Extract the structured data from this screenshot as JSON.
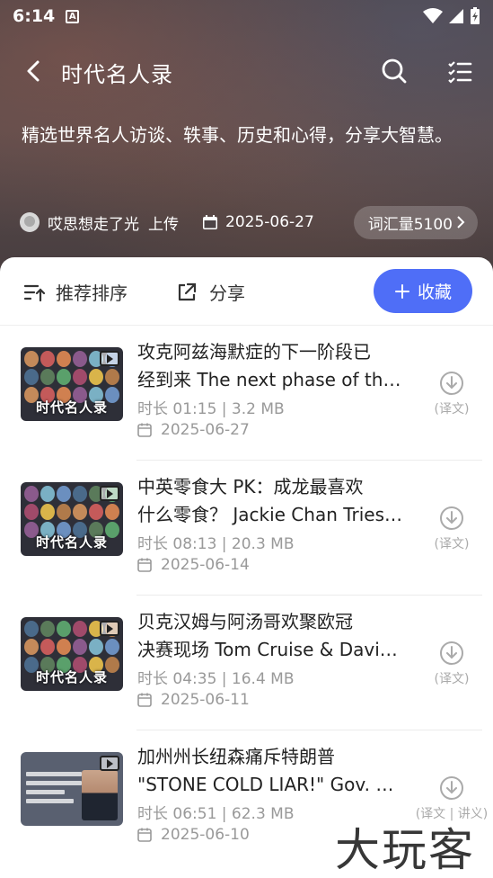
{
  "status_bar": {
    "time": "6:14",
    "notification_icon_letter": "A"
  },
  "header": {
    "title": "时代名人录"
  },
  "description": "精选世界名人访谈、轶事、历史和心得，分享大智慧。",
  "meta": {
    "uploader": "哎思想走了光",
    "action": "上传",
    "date": "2025-06-27",
    "vocab_label": "词汇量5100"
  },
  "toolbar": {
    "sort_label": "推荐排序",
    "share_label": "分享",
    "collect_label": "收藏"
  },
  "colors": {
    "accent": "#4f6ef7",
    "meta_text": "#999999",
    "title_text": "#222222"
  },
  "items": [
    {
      "title_line1": "攻克阿兹海默症的下一阶段已",
      "title_line2": "经到来 The next phase of the ...",
      "meta": "时长 01:15 | 3.2 MB",
      "date": "2025-06-27",
      "thumb_text": "时代名人录",
      "download_label": "(译文)"
    },
    {
      "title_line1": "中英零食大 PK：成龙最喜欢",
      "title_line2": "什么零食？ Jackie Chan Tries ...",
      "meta": "时长 08:13 | 20.3 MB",
      "date": "2025-06-14",
      "thumb_text": "时代名人录",
      "download_label": "(译文)"
    },
    {
      "title_line1": "贝克汉姆与阿汤哥欢聚欧冠",
      "title_line2": "决赛现场 Tom Cruise & David ...",
      "meta": "时长 04:35 | 16.4 MB",
      "date": "2025-06-11",
      "thumb_text": "时代名人录",
      "download_label": "(译文)"
    },
    {
      "title_line1": "加州州长纽森痛斥特朗普",
      "title_line2": "\"STONE COLD LIAR!\" Gov. Ne...",
      "meta": "时长 06:51 | 62.3 MB",
      "date": "2025-06-10",
      "thumb_text": "",
      "download_label": "(译文 | 讲义)"
    }
  ],
  "watermark": "大玩客"
}
